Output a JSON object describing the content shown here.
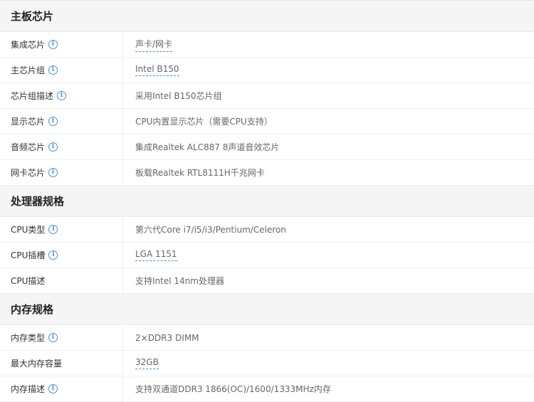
{
  "sections": [
    {
      "title": "主板芯片",
      "rows": [
        {
          "label": "集成芯片",
          "value": "声卡/网卡"
        },
        {
          "label": "主芯片组",
          "value": "Intel B150"
        },
        {
          "label": "芯片组描述",
          "value": "采用Intel B150芯片组"
        },
        {
          "label": "显示芯片",
          "value": "CPU内置显示芯片（需要CPU支持）"
        },
        {
          "label": "音频芯片",
          "value": "集成Realtek ALC887 8声道音效芯片"
        },
        {
          "label": "网卡芯片",
          "value": "板载Realtek RTL8111H千兆网卡"
        }
      ]
    },
    {
      "title": "处理器规格",
      "rows": [
        {
          "label": "CPU类型",
          "value": "第六代Core i7/i5/i3/Pentium/Celeron"
        },
        {
          "label": "CPU插槽",
          "value": "LGA 1151"
        },
        {
          "label": "CPU描述",
          "value": "支持Intel 14nm处理器"
        }
      ]
    },
    {
      "title": "内存规格",
      "rows": [
        {
          "label": "内存类型",
          "value": "2×DDR3 DIMM"
        },
        {
          "label": "最大内存容量",
          "value": "32GB"
        },
        {
          "label": "内存描述",
          "value": "支持双通道DDR3 1866(OC)/1600/1333MHz内存"
        }
      ]
    }
  ],
  "info_icon": "info-circle-icon",
  "colors": {
    "accent": "#4a90d9",
    "header_bg": "#f5f5f5"
  }
}
